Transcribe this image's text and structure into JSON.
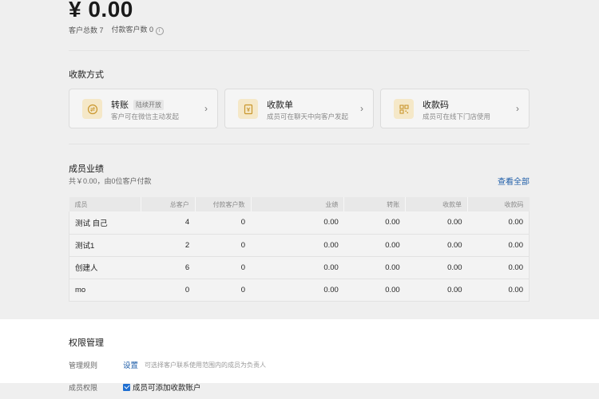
{
  "summary": {
    "amount": "¥ 0.00",
    "total_customers": "客户总数 7",
    "paying_customers": "付款客户数 0"
  },
  "payment_methods": {
    "title": "收款方式",
    "cards": [
      {
        "icon": "transfer-icon",
        "title": "转账",
        "badge": "陆续开放",
        "desc": "客户可在微信主动发起"
      },
      {
        "icon": "bill-icon",
        "title": "收款单",
        "badge": "",
        "desc": "成员可在聊天中向客户发起"
      },
      {
        "icon": "qrcode-icon",
        "title": "收款码",
        "badge": "",
        "desc": "成员可在线下门店使用"
      }
    ],
    "accent_color": "#f5e8c8",
    "icon_color": "#c9962c"
  },
  "performance": {
    "title": "成员业绩",
    "subtitle": "共￥0.00，由0位客户付款",
    "view_all": "查看全部",
    "columns": [
      "成员",
      "总客户",
      "付款客户数",
      "业绩",
      "转账",
      "收款单",
      "收款码"
    ],
    "rows": [
      [
        "测试 自己",
        "4",
        "0",
        "0.00",
        "0.00",
        "0.00",
        "0.00"
      ],
      [
        "测试1",
        "2",
        "0",
        "0.00",
        "0.00",
        "0.00",
        "0.00"
      ],
      [
        "创建人",
        "6",
        "0",
        "0.00",
        "0.00",
        "0.00",
        "0.00"
      ],
      [
        "mo",
        "0",
        "0",
        "0.00",
        "0.00",
        "0.00",
        "0.00"
      ]
    ]
  },
  "permissions": {
    "title": "权限管理",
    "rule_label": "管理规则",
    "rule_link": "设置",
    "rule_note": "可选择客户联系使用范围内的成员为负责人",
    "member_label": "成员权限",
    "member_option": "成员可添加收款账户",
    "member_option_checked": true,
    "link_color": "#1f5ea8"
  }
}
